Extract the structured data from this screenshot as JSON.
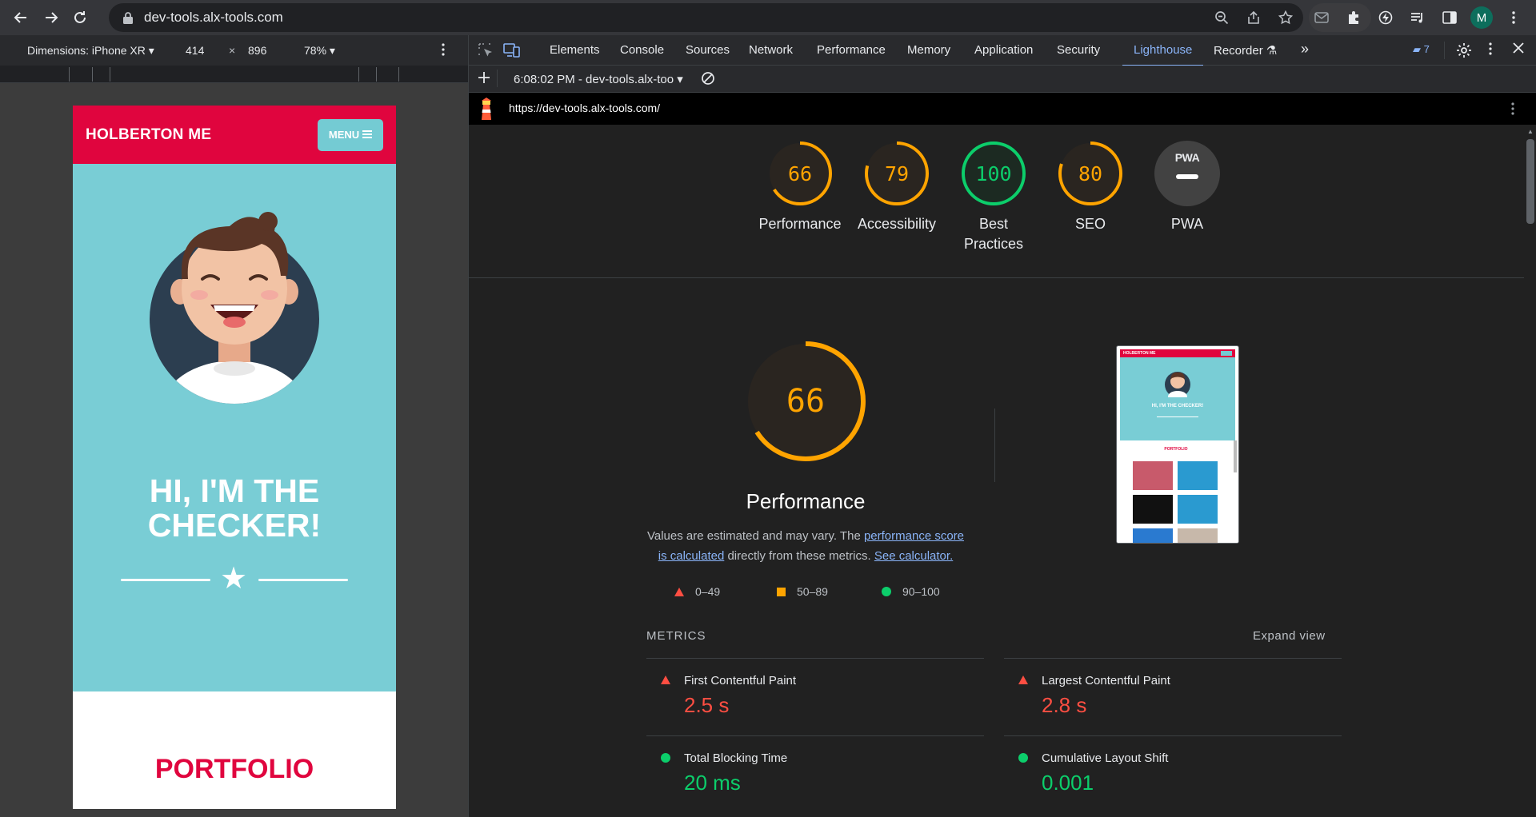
{
  "browser": {
    "url": "dev-tools.alx-tools.com",
    "avatar_letter": "M"
  },
  "device_toolbar": {
    "dimensions_label": "Dimensions: iPhone XR",
    "width": "414",
    "times": "×",
    "height": "896",
    "zoom": "78%"
  },
  "site": {
    "logo": "HOLBERTON ME",
    "menu_label": "MENU",
    "hero_title": "HI, I'M THE CHECKER!",
    "section_title": "PORTFOLIO",
    "colors": {
      "brand": "#e0053e",
      "hero_bg": "#79cdd5"
    }
  },
  "devtools": {
    "tabs": [
      "Elements",
      "Console",
      "Sources",
      "Network",
      "Performance",
      "Memory",
      "Application",
      "Security",
      "Lighthouse",
      "Recorder"
    ],
    "active_tab": "Lighthouse",
    "issues_count": "7",
    "report_selector": "6:08:02 PM - dev-tools.alx-too",
    "report_url": "https://dev-tools.alx-tools.com/"
  },
  "lighthouse": {
    "scores": [
      {
        "label": "Performance",
        "value": "66",
        "status": "average"
      },
      {
        "label": "Accessibility",
        "value": "79",
        "status": "average"
      },
      {
        "label": "Best Practices",
        "value": "100",
        "status": "pass"
      },
      {
        "label": "SEO",
        "value": "80",
        "status": "average"
      },
      {
        "label": "PWA",
        "value": "",
        "status": "na"
      }
    ],
    "pwa_badge": "PWA",
    "performance": {
      "score": "66",
      "title": "Performance",
      "desc_prefix": "Values are estimated and may vary. The ",
      "desc_link1": "performance score is calculated",
      "desc_middle": " directly from these metrics. ",
      "desc_link2": "See calculator."
    },
    "legend": [
      "0–49",
      "50–89",
      "90–100"
    ],
    "metrics_heading": "METRICS",
    "expand_label": "Expand view",
    "metrics": [
      {
        "name": "First Contentful Paint",
        "value": "2.5 s",
        "status": "fail"
      },
      {
        "name": "Largest Contentful Paint",
        "value": "2.8 s",
        "status": "fail"
      },
      {
        "name": "Total Blocking Time",
        "value": "20 ms",
        "status": "pass"
      },
      {
        "name": "Cumulative Layout Shift",
        "value": "0.001",
        "status": "pass"
      }
    ],
    "thumbnail": {
      "logo": "HOLBERTON ME",
      "title": "HI, I'M THE CHECKER!",
      "section": "PORTFOLIO"
    }
  }
}
